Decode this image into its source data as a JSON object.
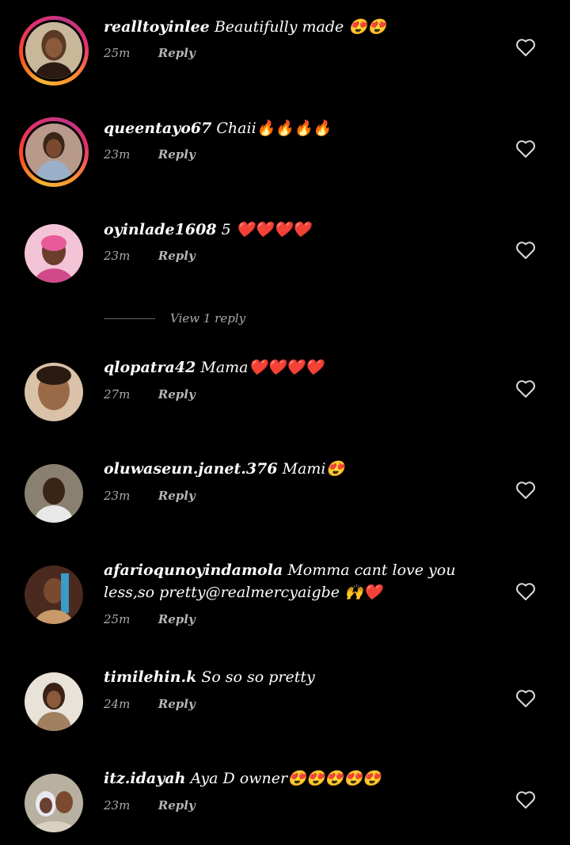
{
  "comments": [
    {
      "username": "realltoyinlee",
      "text": "Beautifully made 😍😍",
      "time": "25m",
      "reply": "Reply"
    },
    {
      "username": "queentayo67",
      "text": "Chaii🔥🔥🔥🔥",
      "time": "23m",
      "reply": "Reply"
    },
    {
      "username": "oyinlade1608",
      "text": "5 ❤️❤️❤️❤️",
      "time": "23m",
      "reply": "Reply"
    },
    {
      "username": "qlopatra42",
      "text": "Mama❤️❤️❤️❤️",
      "time": "27m",
      "reply": "Reply"
    },
    {
      "username": "oluwaseun.janet.376",
      "text": "Mami😍",
      "time": "23m",
      "reply": "Reply"
    },
    {
      "username": "afarioqunoyindamola",
      "text": "Momma cant love you less,so pretty@realmercyaigbe 🙌❤️",
      "time": "25m",
      "reply": "Reply"
    },
    {
      "username": "timilehin.k",
      "text": "So so so pretty",
      "time": "24m",
      "reply": "Reply"
    },
    {
      "username": "itz.idayah",
      "text": "Aya D owner😍😍😍😍😍",
      "time": "23m",
      "reply": "Reply"
    }
  ],
  "view_replies": {
    "label": "View 1 reply"
  },
  "icons": {
    "like": "heart-outline-icon"
  },
  "colors": {
    "background": "#000000",
    "text": "#ffffff",
    "meta": "#aaaaaa"
  }
}
